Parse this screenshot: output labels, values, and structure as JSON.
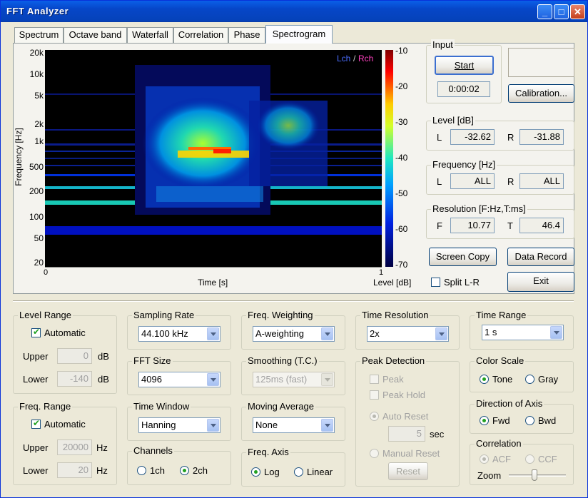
{
  "window": {
    "title": "FFT Analyzer"
  },
  "tabs": [
    "Spectrum",
    "Octave band",
    "Waterfall",
    "Correlation",
    "Phase",
    "Spectrogram"
  ],
  "plot": {
    "legend_l": "Lch",
    "legend_sep": "/",
    "legend_r": "Rch",
    "y_label": "Frequency [Hz]",
    "x_label": "Time [s]",
    "y_ticks": [
      "20k",
      "10k",
      "5k",
      "2k",
      "1k",
      "500",
      "200",
      "100",
      "50",
      "20"
    ],
    "x_ticks": [
      "0",
      "1"
    ],
    "colorbar_ticks": [
      "-10",
      "-20",
      "-30",
      "-40",
      "-50",
      "-60",
      "-70"
    ],
    "colorbar_label": "Level [dB]"
  },
  "input": {
    "title": "Input",
    "start": "Start",
    "time": "0:00:02",
    "calibration": "Calibration..."
  },
  "level": {
    "title": "Level [dB]",
    "l_label": "L",
    "l_value": "-32.62",
    "r_label": "R",
    "r_value": "-31.88"
  },
  "frequency": {
    "title": "Frequency [Hz]",
    "l_label": "L",
    "l_value": "ALL",
    "r_label": "R",
    "r_value": "ALL"
  },
  "resolution": {
    "title": "Resolution [F:Hz,T:ms]",
    "f_label": "F",
    "f_value": "10.77",
    "t_label": "T",
    "t_value": "46.4"
  },
  "actions": {
    "screen_copy": "Screen Copy",
    "data_record": "Data Record",
    "split": "Split L-R",
    "exit": "Exit"
  },
  "level_range": {
    "title": "Level Range",
    "automatic": "Automatic",
    "upper_label": "Upper",
    "upper_value": "0",
    "lower_label": "Lower",
    "lower_value": "-140",
    "unit": "dB"
  },
  "freq_range": {
    "title": "Freq. Range",
    "automatic": "Automatic",
    "upper_label": "Upper",
    "upper_value": "20000",
    "lower_label": "Lower",
    "lower_value": "20",
    "unit": "Hz"
  },
  "sampling_rate": {
    "title": "Sampling Rate",
    "value": "44.100 kHz"
  },
  "fft_size": {
    "title": "FFT Size",
    "value": "4096"
  },
  "time_window": {
    "title": "Time Window",
    "value": "Hanning"
  },
  "channels": {
    "title": "Channels",
    "opt1": "1ch",
    "opt2": "2ch"
  },
  "freq_weighting": {
    "title": "Freq. Weighting",
    "value": "A-weighting"
  },
  "smoothing": {
    "title": "Smoothing (T.C.)",
    "value": "125ms (fast)"
  },
  "moving_average": {
    "title": "Moving Average",
    "value": "None"
  },
  "freq_axis": {
    "title": "Freq. Axis",
    "opt1": "Log",
    "opt2": "Linear"
  },
  "time_resolution": {
    "title": "Time Resolution",
    "value": "2x"
  },
  "peak_detection": {
    "title": "Peak Detection",
    "peak": "Peak",
    "peak_hold": "Peak Hold",
    "auto_reset": "Auto Reset",
    "sec_value": "5",
    "sec_unit": "sec",
    "manual_reset": "Manual Reset",
    "reset": "Reset"
  },
  "time_range": {
    "title": "Time Range",
    "value": "1 s"
  },
  "color_scale": {
    "title": "Color Scale",
    "opt1": "Tone",
    "opt2": "Gray"
  },
  "direction": {
    "title": "Direction of Axis",
    "opt1": "Fwd",
    "opt2": "Bwd"
  },
  "correlation": {
    "title": "Correlation",
    "opt1": "ACF",
    "opt2": "CCF",
    "zoom": "Zoom"
  },
  "colors": {
    "title_bar": "#0646c8",
    "plot_bg": "#000000",
    "lch": "#4a6cff",
    "rch": "#ff40c0"
  }
}
